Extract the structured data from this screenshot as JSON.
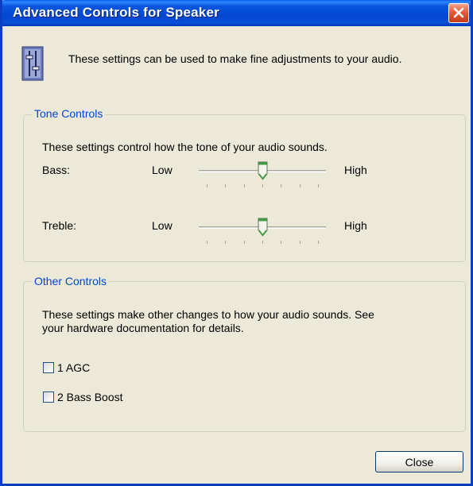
{
  "window": {
    "title": "Advanced Controls for Speaker",
    "intro": "These settings can be used to make fine adjustments to your audio.",
    "close_icon": "close-x-icon",
    "header_icon": "speaker-settings-icon"
  },
  "tone": {
    "legend": "Tone Controls",
    "description": "These settings control how the tone of your audio sounds.",
    "low_label": "Low",
    "high_label": "High",
    "bass": {
      "label": "Bass:",
      "value": 0.5
    },
    "treble": {
      "label": "Treble:",
      "value": 0.5
    }
  },
  "other": {
    "legend": "Other Controls",
    "description_line1": "These settings make other changes to how your audio sounds.  See",
    "description_line2": "your hardware documentation for details.",
    "options": [
      {
        "label": "1  AGC",
        "checked": false
      },
      {
        "label": "2  Bass Boost",
        "checked": false
      }
    ]
  },
  "buttons": {
    "close": "Close"
  },
  "colors": {
    "titlebar": "#0a4fd8",
    "close_button": "#e35a35",
    "legend_text": "#0046d5",
    "dialog_bg": "#ece9d8"
  }
}
